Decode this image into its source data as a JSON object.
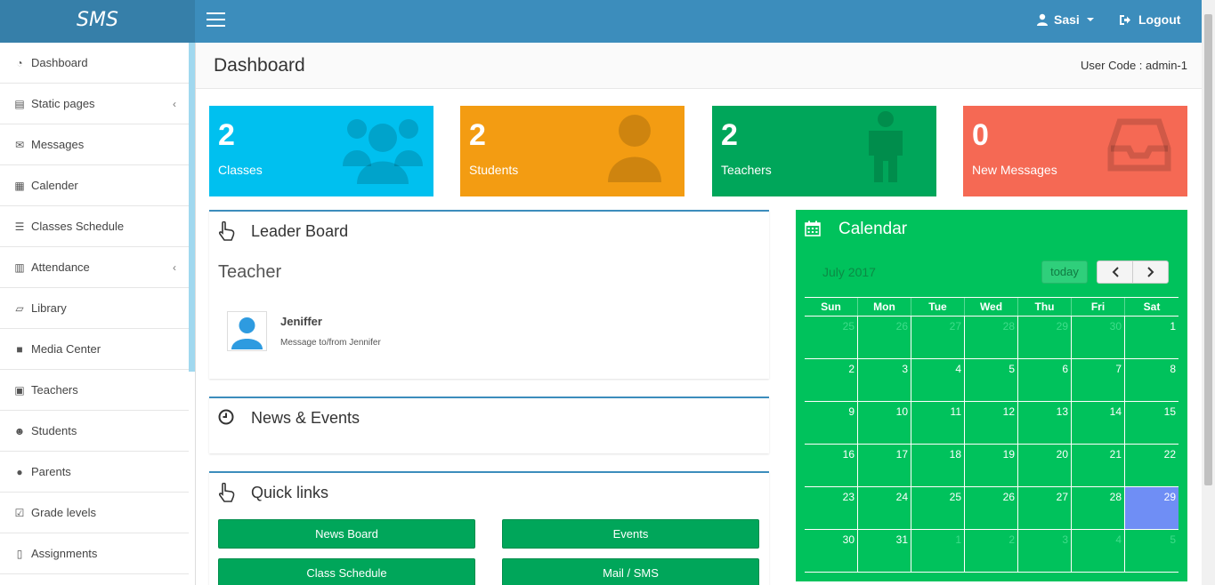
{
  "app": {
    "brand": "SMS"
  },
  "topbar": {
    "user_name": "Sasi",
    "logout_label": "Logout"
  },
  "sidebar": {
    "items": [
      {
        "label": "Dashboard",
        "icon": "dashboard-icon",
        "submenu": false
      },
      {
        "label": "Static pages",
        "icon": "file-icon",
        "submenu": true
      },
      {
        "label": "Messages",
        "icon": "envelope-icon",
        "submenu": false
      },
      {
        "label": "Calender",
        "icon": "calendar-icon",
        "submenu": false
      },
      {
        "label": "Classes Schedule",
        "icon": "list-icon",
        "submenu": false
      },
      {
        "label": "Attendance",
        "icon": "bar-chart-icon",
        "submenu": true
      },
      {
        "label": "Library",
        "icon": "folder-open-icon",
        "submenu": false
      },
      {
        "label": "Media Center",
        "icon": "video-camera-icon",
        "submenu": false
      },
      {
        "label": "Teachers",
        "icon": "briefcase-icon",
        "submenu": false
      },
      {
        "label": "Students",
        "icon": "users-icon",
        "submenu": false
      },
      {
        "label": "Parents",
        "icon": "user-icon",
        "submenu": false
      },
      {
        "label": "Grade levels",
        "icon": "check-square-icon",
        "submenu": false
      },
      {
        "label": "Assignments",
        "icon": "pdf-file-icon",
        "submenu": false
      }
    ]
  },
  "header": {
    "title": "Dashboard",
    "user_code": "User Code : admin-1"
  },
  "stats": [
    {
      "value": "2",
      "label": "Classes",
      "color": "#00c0ef",
      "icon": "users-icon"
    },
    {
      "value": "2",
      "label": "Students",
      "color": "#f39c12",
      "icon": "user-icon"
    },
    {
      "value": "2",
      "label": "Teachers",
      "color": "#00a65a",
      "icon": "male-icon"
    },
    {
      "value": "0",
      "label": "New Messages",
      "color": "#f56954",
      "icon": "inbox-icon"
    }
  ],
  "leaderboard": {
    "title": "Leader Board",
    "section": "Teacher",
    "entries": [
      {
        "name": "Jeniffer",
        "message": "Message to/from Jennifer"
      }
    ]
  },
  "news": {
    "title": "News & Events"
  },
  "quicklinks": {
    "title": "Quick links",
    "buttons": [
      "News Board",
      "Events",
      "Class Schedule",
      "Mail / SMS"
    ]
  },
  "calendar": {
    "title": "Calendar",
    "month": "July 2017",
    "today_label": "today",
    "weekdays": [
      "Sun",
      "Mon",
      "Tue",
      "Wed",
      "Thu",
      "Fri",
      "Sat"
    ],
    "weeks": [
      [
        "25",
        "26",
        "27",
        "28",
        "29",
        "30",
        "1"
      ],
      [
        "2",
        "3",
        "4",
        "5",
        "6",
        "7",
        "8"
      ],
      [
        "9",
        "10",
        "11",
        "12",
        "13",
        "14",
        "15"
      ],
      [
        "16",
        "17",
        "18",
        "19",
        "20",
        "21",
        "22"
      ],
      [
        "23",
        "24",
        "25",
        "26",
        "27",
        "28",
        "29"
      ],
      [
        "30",
        "31",
        "1",
        "2",
        "3",
        "4",
        "5"
      ]
    ],
    "highlight_day": "29",
    "colors": {
      "background": "#00c25c",
      "today": "#6f8ef5"
    }
  }
}
